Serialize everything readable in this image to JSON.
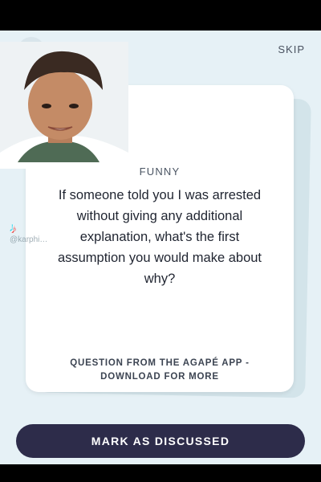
{
  "header": {
    "close_icon": "close-icon",
    "skip_label": "SKIP"
  },
  "card": {
    "category": "FUNNY",
    "question": "If someone told you I was arrested without giving any additional explanation, what's the first assumption you would make about why?",
    "footer": "QUESTION FROM THE AGAPÉ APP - DOWNLOAD FOR MORE"
  },
  "actions": {
    "mark_discussed_label": "MARK AS DISCUSSED"
  },
  "overlay": {
    "watermark_user": "@karphi…"
  },
  "colors": {
    "background": "#e6f1f6",
    "button": "#2d2c4a",
    "card": "#ffffff"
  }
}
